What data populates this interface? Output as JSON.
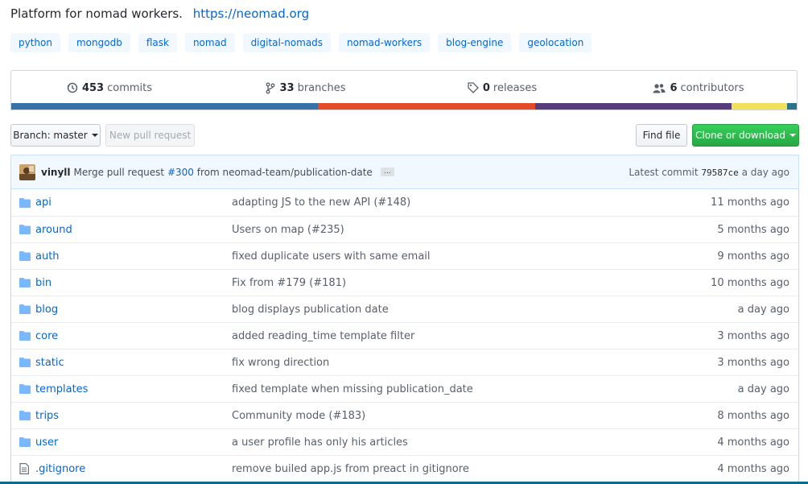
{
  "repo": {
    "description": "Platform for nomad workers.",
    "website": "https://neomad.org",
    "topics": [
      "python",
      "mongodb",
      "flask",
      "nomad",
      "digital-nomads",
      "nomad-workers",
      "blog-engine",
      "geolocation"
    ]
  },
  "summary": {
    "commits": {
      "count": "453",
      "label": "commits",
      "icon": "history-icon"
    },
    "branches": {
      "count": "33",
      "label": "branches",
      "icon": "branch-icon"
    },
    "releases": {
      "count": "0",
      "label": "releases",
      "icon": "tag-icon"
    },
    "contributors": {
      "count": "6",
      "label": "contributors",
      "icon": "people-icon"
    }
  },
  "languages": [
    {
      "color": "#3572A5",
      "percent": 39
    },
    {
      "color": "#e34c26",
      "percent": 27.7
    },
    {
      "color": "#563d7c",
      "percent": 25
    },
    {
      "color": "#f1e05a",
      "percent": 7.1
    },
    {
      "color": "#2b7489",
      "percent": 1.2
    }
  ],
  "toolbar": {
    "branch_label": "Branch: master",
    "new_pr_label": "New pull request",
    "find_file_label": "Find file",
    "clone_label": "Clone or download"
  },
  "commit": {
    "author": "vinyll",
    "message_prefix": "Merge pull request",
    "pr": "#300",
    "message_suffix": "from neomad-team/publication-date",
    "ellipsis": "…",
    "latest_label": "Latest commit",
    "sha": "79587ce",
    "age": "a day ago"
  },
  "files": [
    {
      "name": "api",
      "type": "dir",
      "message": "adapting JS to the new API (#148)",
      "age": "11 months ago"
    },
    {
      "name": "around",
      "type": "dir",
      "message": "Users on map (#235)",
      "age": "5 months ago"
    },
    {
      "name": "auth",
      "type": "dir",
      "message": "fixed duplicate users with same email",
      "age": "9 months ago"
    },
    {
      "name": "bin",
      "type": "dir",
      "message": "Fix from #179 (#181)",
      "age": "10 months ago"
    },
    {
      "name": "blog",
      "type": "dir",
      "message": "blog displays publication date",
      "age": "a day ago"
    },
    {
      "name": "core",
      "type": "dir",
      "message": "added reading_time template filter",
      "age": "3 months ago"
    },
    {
      "name": "static",
      "type": "dir",
      "message": "fix wrong direction",
      "age": "3 months ago"
    },
    {
      "name": "templates",
      "type": "dir",
      "message": "fixed template when missing publication_date",
      "age": "a day ago"
    },
    {
      "name": "trips",
      "type": "dir",
      "message": "Community mode (#183)",
      "age": "8 months ago"
    },
    {
      "name": "user",
      "type": "dir",
      "message": "a user profile has only his articles",
      "age": "4 months ago"
    },
    {
      "name": ".gitignore",
      "type": "file",
      "message": "remove builed app.js from preact in gitignore",
      "age": "4 months ago"
    }
  ]
}
